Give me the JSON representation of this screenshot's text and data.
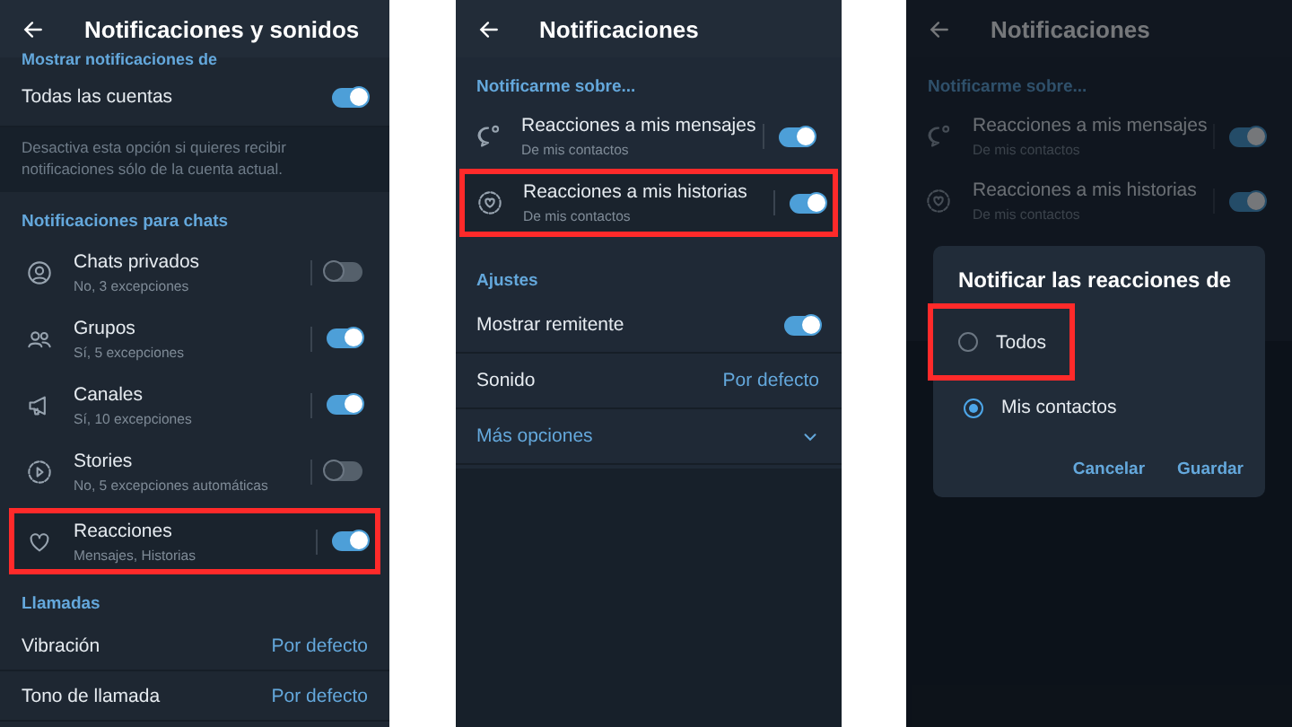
{
  "screen_1": {
    "title": "Notificaciones y sonidos",
    "cut_heading": "Mostrar notificaciones de",
    "accounts_row": {
      "label": "Todas las cuentas",
      "on": true
    },
    "hint": "Desactiva esta opción si quieres recibir notificaciones sólo de la cuenta actual.",
    "chats_section": {
      "heading": "Notificaciones para chats",
      "items": [
        {
          "kind": "person",
          "label": "Chats privados",
          "detail": "No, 3 excepciones",
          "on": false,
          "highlighted": false
        },
        {
          "kind": "people",
          "label": "Grupos",
          "detail": "Sí, 5 excepciones",
          "on": true,
          "highlighted": false
        },
        {
          "kind": "megaphone",
          "label": "Canales",
          "detail": "Sí, 10 excepciones",
          "on": true,
          "highlighted": false
        },
        {
          "kind": "stories",
          "label": "Stories",
          "detail": "No, 5 excepciones automáticas",
          "on": false,
          "highlighted": false
        },
        {
          "kind": "heart",
          "label": "Reacciones",
          "detail": "Mensajes, Historias",
          "on": true,
          "highlighted": true
        }
      ]
    },
    "calls_section": {
      "heading": "Llamadas",
      "items": [
        {
          "label": "Vibración",
          "value": "Por defecto"
        },
        {
          "label": "Tono de llamada",
          "value": "Por defecto"
        }
      ]
    }
  },
  "screen_2": {
    "title": "Notificaciones",
    "section": {
      "heading": "Notificarme sobre...",
      "items": [
        {
          "kind": "bubble",
          "label": "Reacciones a mis mensajes",
          "detail": "De mis contactos",
          "on": true,
          "highlighted": false
        },
        {
          "kind": "heart-ring",
          "label": "Reacciones a mis historias",
          "detail": "De mis contactos",
          "on": true,
          "highlighted": true
        }
      ]
    },
    "settings": {
      "heading": "Ajustes",
      "items": [
        {
          "kind": "toggle",
          "label": "Mostrar remitente",
          "on": true
        },
        {
          "kind": "value",
          "label": "Sonido",
          "value": "Por defecto"
        },
        {
          "kind": "expand",
          "label": "Más opciones",
          "expanded": false
        }
      ]
    }
  },
  "screen_3": {
    "title": "Notificaciones",
    "section": {
      "heading": "Notificarme sobre...",
      "items": [
        {
          "kind": "bubble",
          "label": "Reacciones a mis mensajes",
          "detail": "De mis contactos",
          "on": true,
          "highlighted": false
        },
        {
          "kind": "heart-ring",
          "label": "Reacciones a mis historias",
          "detail": "De mis contactos",
          "on": true,
          "highlighted": false
        }
      ]
    },
    "dialog": {
      "title": "Notificar las reacciones de",
      "options": [
        {
          "label": "Todos",
          "selected": false,
          "highlighted": true
        },
        {
          "label": "Mis contactos",
          "selected": true,
          "highlighted": false
        }
      ],
      "buttons": [
        "Cancelar",
        "Guardar"
      ]
    }
  }
}
